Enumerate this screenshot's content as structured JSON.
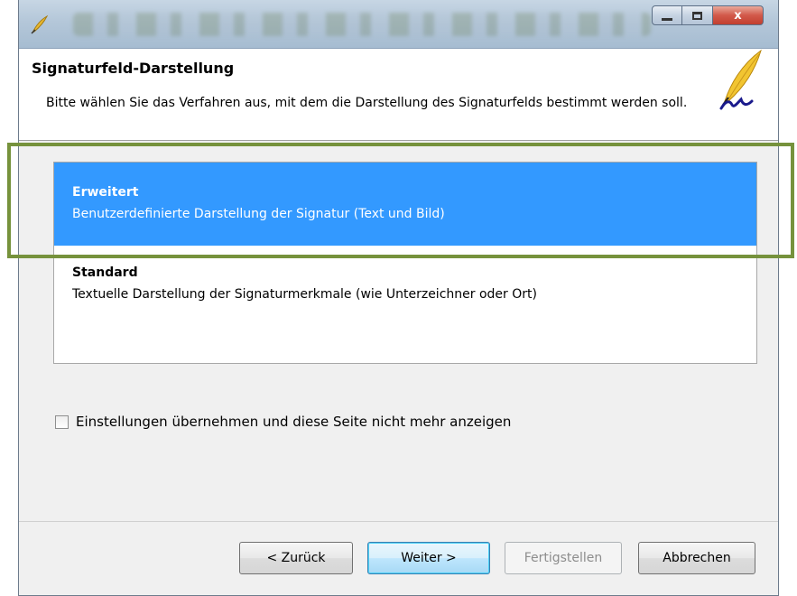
{
  "titlebar": {
    "controls": {
      "minimize_icon": "minimize-icon",
      "maximize_icon": "maximize-icon",
      "close_glyph": "x"
    }
  },
  "header": {
    "title": "Signaturfeld-Darstellung",
    "description": "Bitte wählen Sie das Verfahren aus, mit dem die Darstellung des Signaturfelds bestimmt werden soll.",
    "logo_icon": "quill-pen-icon"
  },
  "options": [
    {
      "title": "Erweitert",
      "description": "Benutzerdefinierte Darstellung der Signatur (Text und Bild)",
      "selected": true
    },
    {
      "title": "Standard",
      "description": "Textuelle Darstellung der Signaturmerkmale (wie Unterzeichner oder Ort)",
      "selected": false
    }
  ],
  "checkbox": {
    "label": "Einstellungen übernehmen und diese Seite nicht mehr anzeigen",
    "checked": false
  },
  "buttons": {
    "back": "< Zurück",
    "next": "Weiter >",
    "finish": "Fertigstellen",
    "cancel": "Abbrechen"
  },
  "colors": {
    "selection": "#3399ff",
    "highlight_border": "#76923c",
    "window_bg": "#f0f0f0"
  }
}
